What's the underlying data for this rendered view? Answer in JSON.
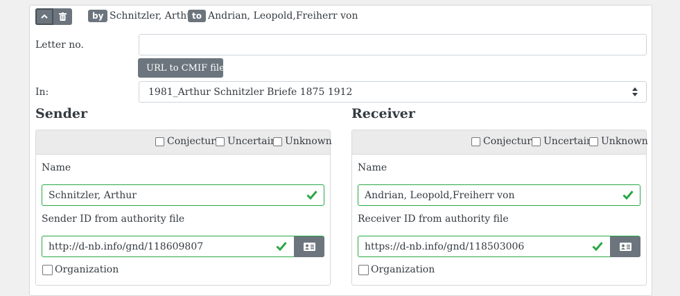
{
  "header": {
    "by_badge": "by",
    "sender_name": "Schnitzler, Arthur",
    "to_badge": "to",
    "receiver_name": "Andrian, Leopold,Freiherr von"
  },
  "letter_no": {
    "label": "Letter no.",
    "value": ""
  },
  "cmif_button": {
    "label": "URL to CMIF file"
  },
  "in_field": {
    "label": "In:",
    "selected": "1981_Arthur Schnitzler Briefe 1875 1912"
  },
  "sender": {
    "title": "Sender",
    "flags": [
      "Conjecture",
      "Uncertain",
      "Unknown"
    ],
    "name_label": "Name",
    "name_value": "Schnitzler, Arthur",
    "id_label": "Sender ID from authority file",
    "id_value": "http://d-nb.info/gnd/118609807",
    "org_label": "Organization"
  },
  "receiver": {
    "title": "Receiver",
    "flags": [
      "Conjecture",
      "Uncertain",
      "Unknown"
    ],
    "name_label": "Name",
    "name_value": "Andrian, Leopold,Freiherr von",
    "id_label": "Receiver ID from authority file",
    "id_value": "https://d-nb.info/gnd/118503006",
    "org_label": "Organization"
  },
  "colors": {
    "success": "#28a745",
    "button": "#6c757d",
    "panel_header": "#ebebeb"
  },
  "icons": [
    "chevron-up-icon",
    "trash-icon",
    "chevron-down-icon",
    "checkmark-icon",
    "id-card-icon",
    "select-arrows-icon"
  ]
}
